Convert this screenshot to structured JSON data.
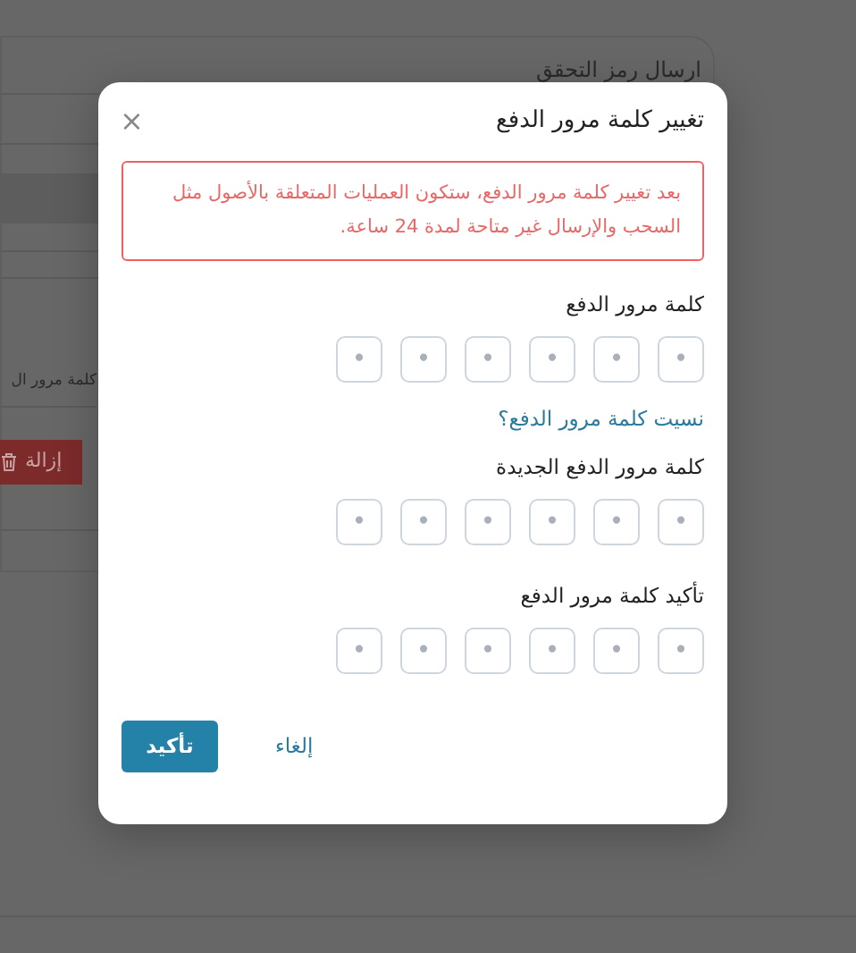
{
  "background": {
    "heading": "ارسال رمز التحقق",
    "field_value": "كلمة مرور ال",
    "remove_button": "إزالة"
  },
  "dialog": {
    "title": "تغيير كلمة مرور الدفع",
    "close": "×",
    "alert": "بعد تغيير كلمة مرور الدفع، ستكون العمليات المتعلقة بالأصول مثل السحب والإرسال غير متاحة لمدة 24 ساعة.",
    "fields": [
      {
        "kind": "pin",
        "label": "كلمة مرور الدفع",
        "cells": [
          {
            "placeholder": "•"
          },
          {
            "placeholder": "•"
          },
          {
            "placeholder": "•"
          },
          {
            "placeholder": "•"
          },
          {
            "placeholder": "•"
          },
          {
            "placeholder": "•"
          }
        ]
      },
      {
        "kind": "link",
        "text": "نسيت كلمة مرور الدفع؟"
      },
      {
        "kind": "pin",
        "label": "كلمة مرور الدفع الجديدة",
        "cells": [
          {
            "placeholder": "•"
          },
          {
            "placeholder": "•"
          },
          {
            "placeholder": "•"
          },
          {
            "placeholder": "•"
          },
          {
            "placeholder": "•"
          },
          {
            "placeholder": "•"
          }
        ]
      },
      {
        "kind": "pin",
        "label": "تأكيد كلمة مرور الدفع",
        "cells": [
          {
            "placeholder": "•"
          },
          {
            "placeholder": "•"
          },
          {
            "placeholder": "•"
          },
          {
            "placeholder": "•"
          },
          {
            "placeholder": "•"
          },
          {
            "placeholder": "•"
          }
        ]
      }
    ],
    "buttons": [
      {
        "kind": "text",
        "label": "إلغاء"
      },
      {
        "kind": "primary",
        "label": "تأكيد"
      }
    ]
  }
}
